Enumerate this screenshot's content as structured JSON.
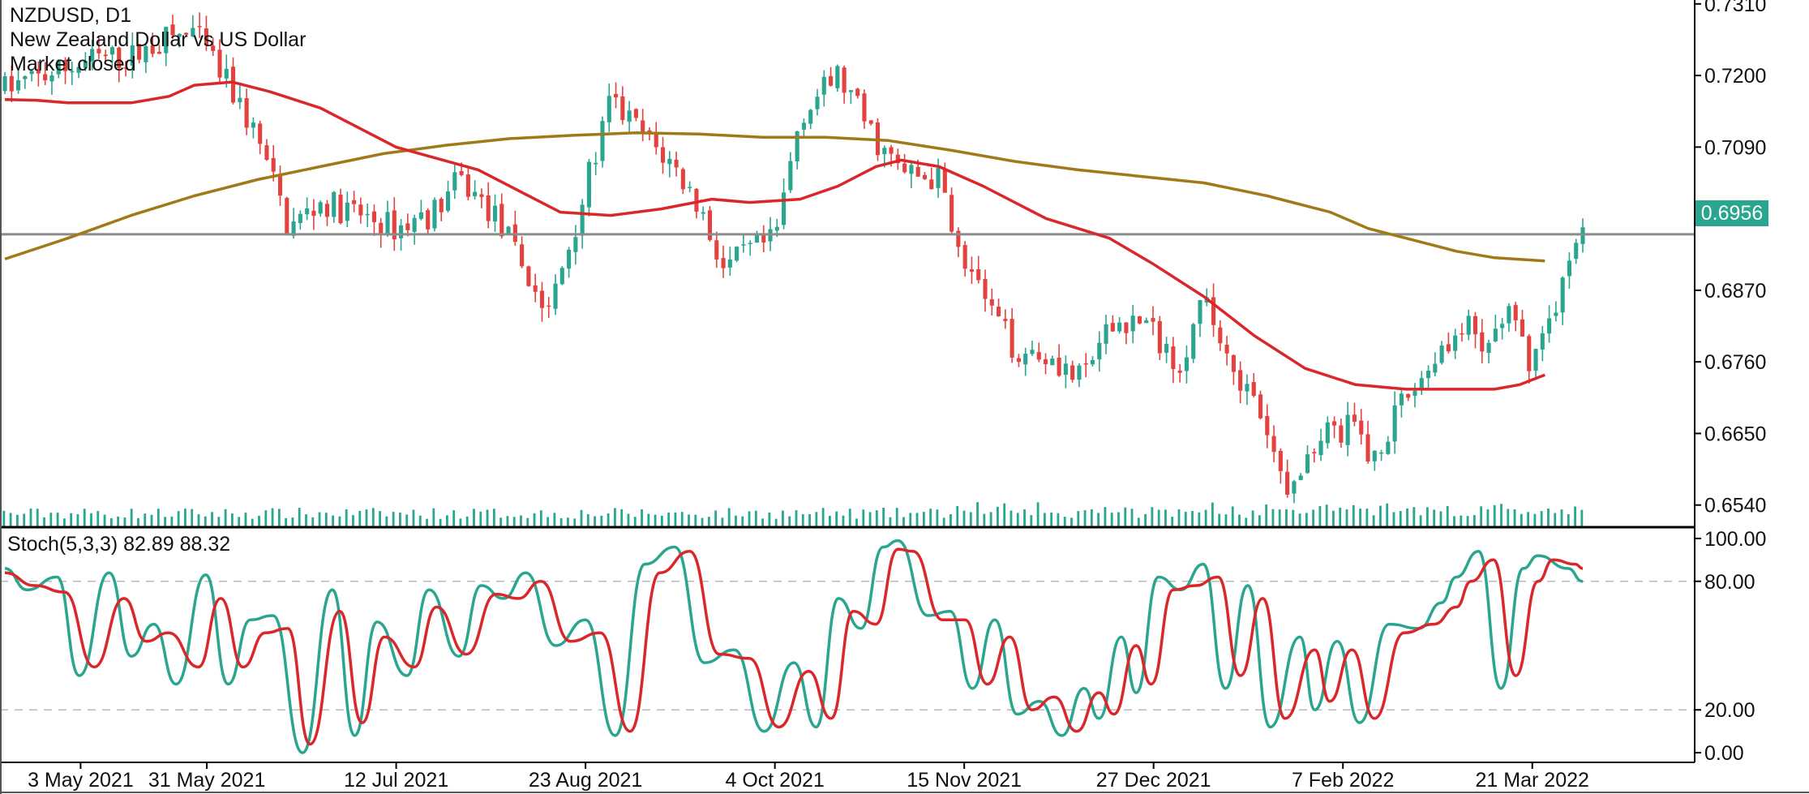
{
  "header": {
    "symbol": "NZDUSD, D1",
    "description": "New Zealand Dollar vs US Dollar",
    "status": "Market closed"
  },
  "indicator": {
    "name": "Stoch(5,3,3)",
    "main_value": "82.89",
    "signal_value": "88.32",
    "label": "Stoch(5,3,3) 82.89 88.32"
  },
  "current_price": "0.6956",
  "colors": {
    "bull": "#2aa58f",
    "bear": "#e3423f",
    "ma_fast": "#d9272a",
    "ma_slow": "#a07a18",
    "price_line": "#8c8c8c",
    "stoch_main": "#2aa58f",
    "stoch_signal": "#d9272a",
    "volume": "#2aa58f"
  },
  "chart_data": [
    {
      "type": "candlestick",
      "title": "NZDUSD, D1",
      "price_ticks": [
        "0.7310",
        "0.7200",
        "0.7090",
        "0.6980",
        "0.6870",
        "0.6760",
        "0.6650",
        "0.6540"
      ],
      "price_tick_values": [
        0.731,
        0.72,
        0.709,
        0.698,
        0.687,
        0.676,
        0.665,
        0.654
      ],
      "ylim": [
        0.6506,
        0.7316
      ],
      "current_price": 0.6956,
      "date_labels": [
        "3 May 2021",
        "31 May 2021",
        "12 Jul 2021",
        "23 Aug 2021",
        "4 Oct 2021",
        "15 Nov 2021",
        "27 Dec 2021",
        "7 Feb 2022",
        "21 Mar 2022"
      ],
      "date_label_bar_index": [
        12,
        32,
        62,
        92,
        122,
        152,
        182,
        212,
        242
      ],
      "bar_count": 236,
      "close_path": [
        [
          0,
          0.718
        ],
        [
          8,
          0.7205
        ],
        [
          14,
          0.7225
        ],
        [
          20,
          0.7228
        ],
        [
          26,
          0.7258
        ],
        [
          30,
          0.7265
        ],
        [
          36,
          0.7175
        ],
        [
          40,
          0.7105
        ],
        [
          45,
          0.6965
        ],
        [
          50,
          0.7005
        ],
        [
          55,
          0.699
        ],
        [
          62,
          0.6965
        ],
        [
          68,
          0.699
        ],
        [
          72,
          0.704
        ],
        [
          78,
          0.698
        ],
        [
          84,
          0.687
        ],
        [
          86,
          0.683
        ],
        [
          90,
          0.696
        ],
        [
          96,
          0.716
        ],
        [
          102,
          0.71
        ],
        [
          106,
          0.706
        ],
        [
          110,
          0.7
        ],
        [
          114,
          0.69
        ],
        [
          118,
          0.693
        ],
        [
          122,
          0.6945
        ],
        [
          126,
          0.714
        ],
        [
          132,
          0.72
        ],
        [
          138,
          0.71
        ],
        [
          142,
          0.705
        ],
        [
          148,
          0.704
        ],
        [
          152,
          0.692
        ],
        [
          156,
          0.684
        ],
        [
          160,
          0.678
        ],
        [
          166,
          0.677
        ],
        [
          170,
          0.673
        ],
        [
          176,
          0.682
        ],
        [
          180,
          0.6825
        ],
        [
          186,
          0.676
        ],
        [
          190,
          0.685
        ],
        [
          194,
          0.677
        ],
        [
          198,
          0.669
        ],
        [
          202,
          0.659
        ],
        [
          204,
          0.656
        ],
        [
          208,
          0.665
        ],
        [
          214,
          0.666
        ],
        [
          216,
          0.661
        ],
        [
          222,
          0.67
        ],
        [
          228,
          0.679
        ],
        [
          232,
          0.681
        ],
        [
          234,
          0.677
        ],
        [
          238,
          0.684
        ],
        [
          240,
          0.679
        ],
        [
          242,
          0.676
        ],
        [
          246,
          0.686
        ],
        [
          250,
          0.696
        ]
      ],
      "ma_fast_path": [
        [
          0,
          0.7163
        ],
        [
          5,
          0.7162
        ],
        [
          10,
          0.7158
        ],
        [
          20,
          0.7158
        ],
        [
          26,
          0.7168
        ],
        [
          30,
          0.7185
        ],
        [
          36,
          0.719
        ],
        [
          42,
          0.7175
        ],
        [
          50,
          0.715
        ],
        [
          62,
          0.709
        ],
        [
          75,
          0.7055
        ],
        [
          84,
          0.701
        ],
        [
          88,
          0.699
        ],
        [
          96,
          0.6985
        ],
        [
          104,
          0.6995
        ],
        [
          112,
          0.701
        ],
        [
          118,
          0.7005
        ],
        [
          126,
          0.701
        ],
        [
          132,
          0.703
        ],
        [
          138,
          0.706
        ],
        [
          142,
          0.707
        ],
        [
          148,
          0.706
        ],
        [
          155,
          0.703
        ],
        [
          165,
          0.698
        ],
        [
          175,
          0.695
        ],
        [
          182,
          0.691
        ],
        [
          190,
          0.686
        ],
        [
          198,
          0.68
        ],
        [
          206,
          0.675
        ],
        [
          214,
          0.6725
        ],
        [
          222,
          0.6718
        ],
        [
          230,
          0.6718
        ],
        [
          236,
          0.6718
        ],
        [
          240,
          0.6725
        ],
        [
          244,
          0.674
        ]
      ],
      "ma_slow_path": [
        [
          0,
          0.6918
        ],
        [
          10,
          0.695
        ],
        [
          20,
          0.6985
        ],
        [
          30,
          0.7015
        ],
        [
          40,
          0.704
        ],
        [
          50,
          0.706
        ],
        [
          60,
          0.708
        ],
        [
          70,
          0.7093
        ],
        [
          80,
          0.7103
        ],
        [
          90,
          0.7108
        ],
        [
          100,
          0.7112
        ],
        [
          110,
          0.711
        ],
        [
          120,
          0.7105
        ],
        [
          130,
          0.7105
        ],
        [
          140,
          0.71
        ],
        [
          150,
          0.7085
        ],
        [
          160,
          0.7068
        ],
        [
          170,
          0.7055
        ],
        [
          180,
          0.7045
        ],
        [
          190,
          0.7035
        ],
        [
          200,
          0.7015
        ],
        [
          210,
          0.699
        ],
        [
          216,
          0.6965
        ],
        [
          222,
          0.695
        ],
        [
          230,
          0.693
        ],
        [
          236,
          0.692
        ],
        [
          244,
          0.6915
        ]
      ]
    },
    {
      "type": "line",
      "title": "Stoch(5,3,3)",
      "ticks": [
        "100.00",
        "80.00",
        "20.00",
        "0.00"
      ],
      "tick_values": [
        100,
        80,
        20,
        0
      ],
      "levels": [
        80,
        20
      ],
      "ylim": [
        -3,
        103
      ],
      "series": [
        {
          "name": "Main",
          "value": 82.89,
          "points": [
            [
              0,
              86
            ],
            [
              3,
              76
            ],
            [
              7,
              82
            ],
            [
              10,
              36
            ],
            [
              14,
              84
            ],
            [
              17,
              45
            ],
            [
              20,
              60
            ],
            [
              23,
              32
            ],
            [
              27,
              83
            ],
            [
              30,
              32
            ],
            [
              33,
              62
            ],
            [
              36,
              64
            ],
            [
              40,
              0
            ],
            [
              44,
              76
            ],
            [
              47,
              8
            ],
            [
              50,
              61
            ],
            [
              54,
              36
            ],
            [
              57,
              76
            ],
            [
              61,
              45
            ],
            [
              64,
              78
            ],
            [
              67,
              72
            ],
            [
              70,
              84
            ],
            [
              74,
              50
            ],
            [
              78,
              62
            ],
            [
              82,
              8
            ],
            [
              86,
              88
            ],
            [
              90,
              96
            ],
            [
              94,
              42
            ],
            [
              98,
              48
            ],
            [
              102,
              10
            ],
            [
              106,
              42
            ],
            [
              109,
              12
            ],
            [
              112,
              72
            ],
            [
              115,
              58
            ],
            [
              118,
              96
            ],
            [
              120,
              99
            ],
            [
              124,
              64
            ],
            [
              127,
              66
            ],
            [
              130,
              30
            ],
            [
              133,
              62
            ],
            [
              136,
              18
            ],
            [
              139,
              24
            ],
            [
              142,
              8
            ],
            [
              145,
              30
            ],
            [
              147,
              16
            ],
            [
              150,
              54
            ],
            [
              152,
              28
            ],
            [
              155,
              82
            ],
            [
              158,
              76
            ],
            [
              161,
              88
            ],
            [
              164,
              30
            ],
            [
              167,
              78
            ],
            [
              170,
              12
            ],
            [
              174,
              54
            ],
            [
              176,
              20
            ],
            [
              179,
              52
            ],
            [
              182,
              14
            ],
            [
              186,
              60
            ],
            [
              190,
              58
            ],
            [
              193,
              70
            ],
            [
              195,
              82
            ],
            [
              198,
              94
            ],
            [
              201,
              30
            ],
            [
              204,
              86
            ],
            [
              206,
              92
            ],
            [
              210,
              86
            ],
            [
              212,
              80
            ]
          ]
        },
        {
          "name": "Signal",
          "value": 88.32,
          "points": [
            [
              0,
              84
            ],
            [
              4,
              78
            ],
            [
              8,
              75
            ],
            [
              12,
              40
            ],
            [
              16,
              72
            ],
            [
              19,
              52
            ],
            [
              22,
              56
            ],
            [
              26,
              40
            ],
            [
              29,
              72
            ],
            [
              32,
              40
            ],
            [
              35,
              56
            ],
            [
              38,
              58
            ],
            [
              41,
              4
            ],
            [
              45,
              66
            ],
            [
              48,
              14
            ],
            [
              51,
              54
            ],
            [
              55,
              40
            ],
            [
              58,
              68
            ],
            [
              62,
              46
            ],
            [
              66,
              74
            ],
            [
              69,
              72
            ],
            [
              72,
              80
            ],
            [
              76,
              52
            ],
            [
              80,
              56
            ],
            [
              84,
              10
            ],
            [
              88,
              84
            ],
            [
              92,
              94
            ],
            [
              96,
              46
            ],
            [
              100,
              44
            ],
            [
              104,
              12
            ],
            [
              108,
              38
            ],
            [
              111,
              16
            ],
            [
              114,
              66
            ],
            [
              117,
              60
            ],
            [
              120,
              95
            ],
            [
              122,
              94
            ],
            [
              126,
              62
            ],
            [
              129,
              62
            ],
            [
              132,
              32
            ],
            [
              135,
              54
            ],
            [
              138,
              20
            ],
            [
              141,
              26
            ],
            [
              144,
              10
            ],
            [
              147,
              28
            ],
            [
              149,
              18
            ],
            [
              152,
              50
            ],
            [
              154,
              32
            ],
            [
              157,
              76
            ],
            [
              160,
              78
            ],
            [
              163,
              82
            ],
            [
              166,
              36
            ],
            [
              169,
              72
            ],
            [
              172,
              16
            ],
            [
              176,
              48
            ],
            [
              178,
              24
            ],
            [
              181,
              48
            ],
            [
              184,
              16
            ],
            [
              188,
              56
            ],
            [
              192,
              60
            ],
            [
              195,
              68
            ],
            [
              197,
              80
            ],
            [
              200,
              90
            ],
            [
              203,
              36
            ],
            [
              206,
              80
            ],
            [
              208,
              90
            ],
            [
              211,
              88
            ],
            [
              212,
              86
            ]
          ]
        }
      ]
    }
  ]
}
